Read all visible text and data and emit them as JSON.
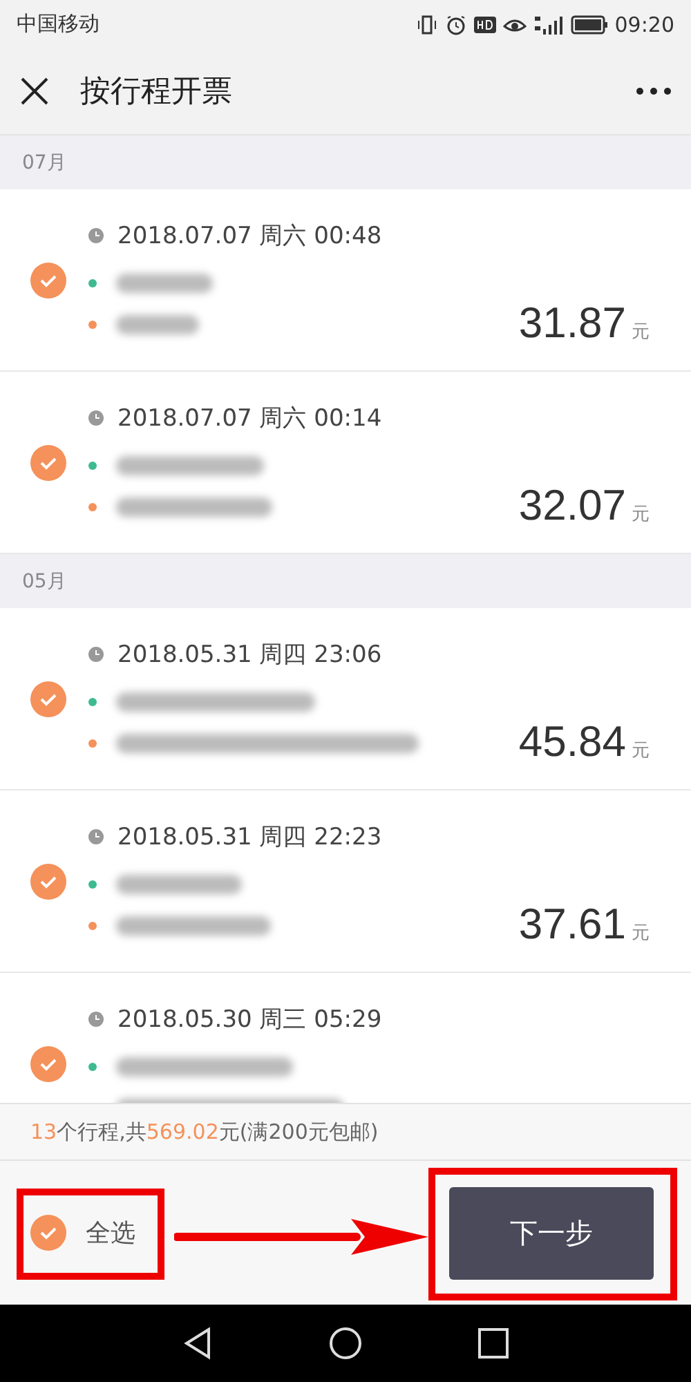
{
  "status_bar": {
    "carrier": "中国移动",
    "time": "09:20"
  },
  "header": {
    "title": "按行程开票"
  },
  "months": [
    {
      "label": "07月",
      "trips": [
        {
          "selected": true,
          "datetime": "2018.07.07 周六 00:48",
          "amount": "31.87",
          "currency": "元"
        },
        {
          "selected": true,
          "datetime": "2018.07.07 周六 00:14",
          "amount": "32.07",
          "currency": "元"
        }
      ]
    },
    {
      "label": "05月",
      "trips": [
        {
          "selected": true,
          "datetime": "2018.05.31 周四 23:06",
          "amount": "45.84",
          "currency": "元"
        },
        {
          "selected": true,
          "datetime": "2018.05.31 周四 22:23",
          "amount": "37.61",
          "currency": "元"
        },
        {
          "selected": true,
          "datetime": "2018.05.30 周三 05:29"
        }
      ]
    }
  ],
  "summary": {
    "count": "13",
    "text_1": "个行程,共",
    "total": "569.02",
    "text_2": "元(满200元包邮)"
  },
  "footer": {
    "select_all": {
      "label": "全选",
      "checked": true
    },
    "next_button": "下一步"
  }
}
